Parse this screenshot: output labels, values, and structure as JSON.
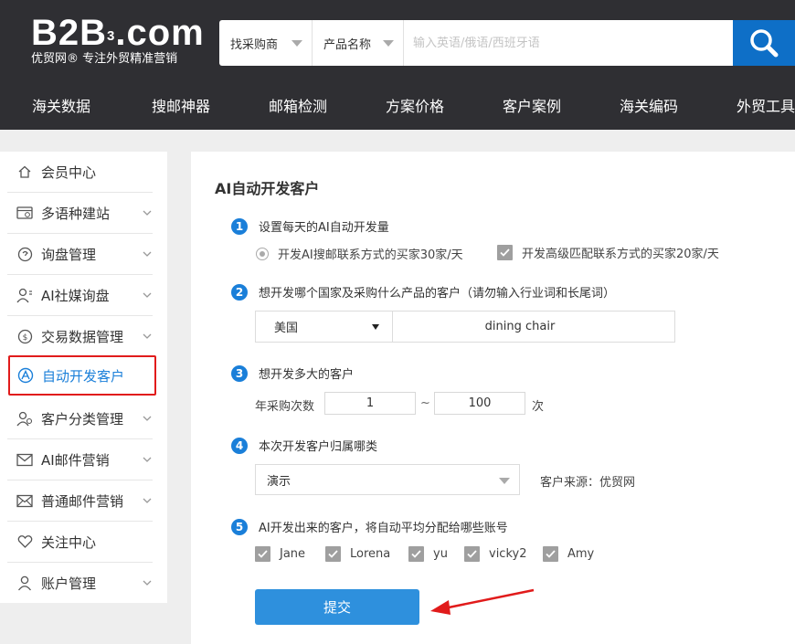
{
  "header": {
    "logo_text": "B2B",
    "logo_sup": "3",
    "logo_domain": ".com",
    "logo_subtitle": "优贸网® 专注外贸精准营销",
    "search": {
      "type_select": "找采购商",
      "field_select": "产品名称",
      "placeholder": "输入英语/俄语/西班牙语",
      "button_icon": "search-icon"
    }
  },
  "nav": {
    "items": [
      "海关数据",
      "搜邮神器",
      "邮箱检测",
      "方案价格",
      "客户案例",
      "海关编码",
      "外贸工具"
    ]
  },
  "sidebar": {
    "items": [
      {
        "label": "会员中心",
        "icon": "home-icon",
        "expandable": false
      },
      {
        "label": "多语种建站",
        "icon": "website-icon",
        "expandable": true
      },
      {
        "label": "询盘管理",
        "icon": "inquiry-icon",
        "expandable": true
      },
      {
        "label": "AI社媒询盘",
        "icon": "social-user-icon",
        "expandable": true
      },
      {
        "label": "交易数据管理",
        "icon": "trade-data-icon",
        "expandable": true
      },
      {
        "label": "自动开发客户",
        "icon": "ai-develop-icon",
        "expandable": false,
        "active": true
      },
      {
        "label": "客户分类管理",
        "icon": "customers-icon",
        "expandable": true
      },
      {
        "label": "AI邮件营销",
        "icon": "ai-mail-icon",
        "expandable": true
      },
      {
        "label": "普通邮件营销",
        "icon": "mail-icon",
        "expandable": true
      },
      {
        "label": "关注中心",
        "icon": "heart-icon",
        "expandable": false
      },
      {
        "label": "账户管理",
        "icon": "account-icon",
        "expandable": true
      }
    ]
  },
  "main": {
    "title": "AI自动开发客户",
    "steps": [
      {
        "num": "1",
        "text": "设置每天的AI自动开发量"
      },
      {
        "num": "2",
        "text": "想开发哪个国家及采购什么产品的客户（请勿输入行业词和长尾词）"
      },
      {
        "num": "3",
        "text": "想开发多大的客户"
      },
      {
        "num": "4",
        "text": "本次开发客户归属哪类"
      },
      {
        "num": "5",
        "text": "AI开发出来的客户，将自动平均分配给哪些账号"
      }
    ],
    "quota": {
      "option1": "开发AI搜邮联系方式的买家30家/天",
      "option2": "开发高级匹配联系方式的买家20家/天",
      "option2_checked": true
    },
    "country": "美国",
    "product": "dining chair",
    "purchase": {
      "label": "年采购次数",
      "min": "1",
      "separator": "~",
      "max": "100",
      "unit": "次"
    },
    "group": {
      "value": "演示",
      "source_label": "客户来源：优贸网"
    },
    "accounts": [
      "Jane",
      "Lorena",
      "yu",
      "vicky2",
      "Amy"
    ],
    "submit_label": "提交"
  },
  "colors": {
    "header_bg": "#2f2f33",
    "accent": "#1a7fd9",
    "search_button": "#0e6fc7",
    "submit": "#2e90dd",
    "highlight": "#e11b1b"
  }
}
